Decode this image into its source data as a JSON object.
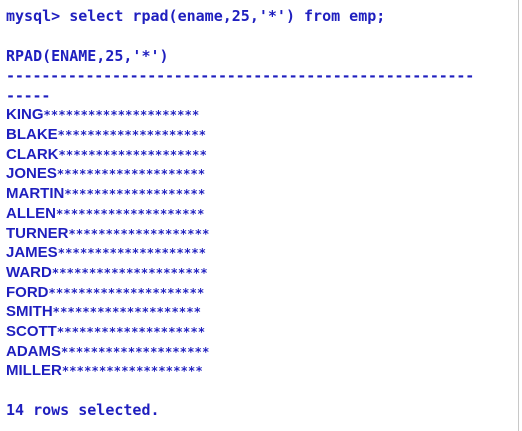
{
  "command_line": "mysql> select rpad(ename,25,'*') from emp;",
  "column_header": "RPAD(ENAME,25,'*')",
  "separator_line_1": "-----------------------------------------------------",
  "separator_line_2": "-----",
  "rows": [
    {
      "name": "KING",
      "padding": "*********************"
    },
    {
      "name": "BLAKE",
      "padding": "********************"
    },
    {
      "name": "CLARK",
      "padding": "********************"
    },
    {
      "name": "JONES",
      "padding": "********************"
    },
    {
      "name": "MARTIN",
      "padding": "*******************"
    },
    {
      "name": "ALLEN",
      "padding": "********************"
    },
    {
      "name": "TURNER",
      "padding": "*******************"
    },
    {
      "name": "JAMES",
      "padding": "********************"
    },
    {
      "name": "WARD",
      "padding": "*********************"
    },
    {
      "name": "FORD",
      "padding": "*********************"
    },
    {
      "name": "SMITH",
      "padding": "********************"
    },
    {
      "name": "SCOTT",
      "padding": "********************"
    },
    {
      "name": "ADAMS",
      "padding": "********************"
    },
    {
      "name": "MILLER",
      "padding": "*******************"
    }
  ],
  "footer": "14 rows selected.",
  "colors": {
    "text": "#1f1fbf",
    "background": "#ffffff"
  }
}
